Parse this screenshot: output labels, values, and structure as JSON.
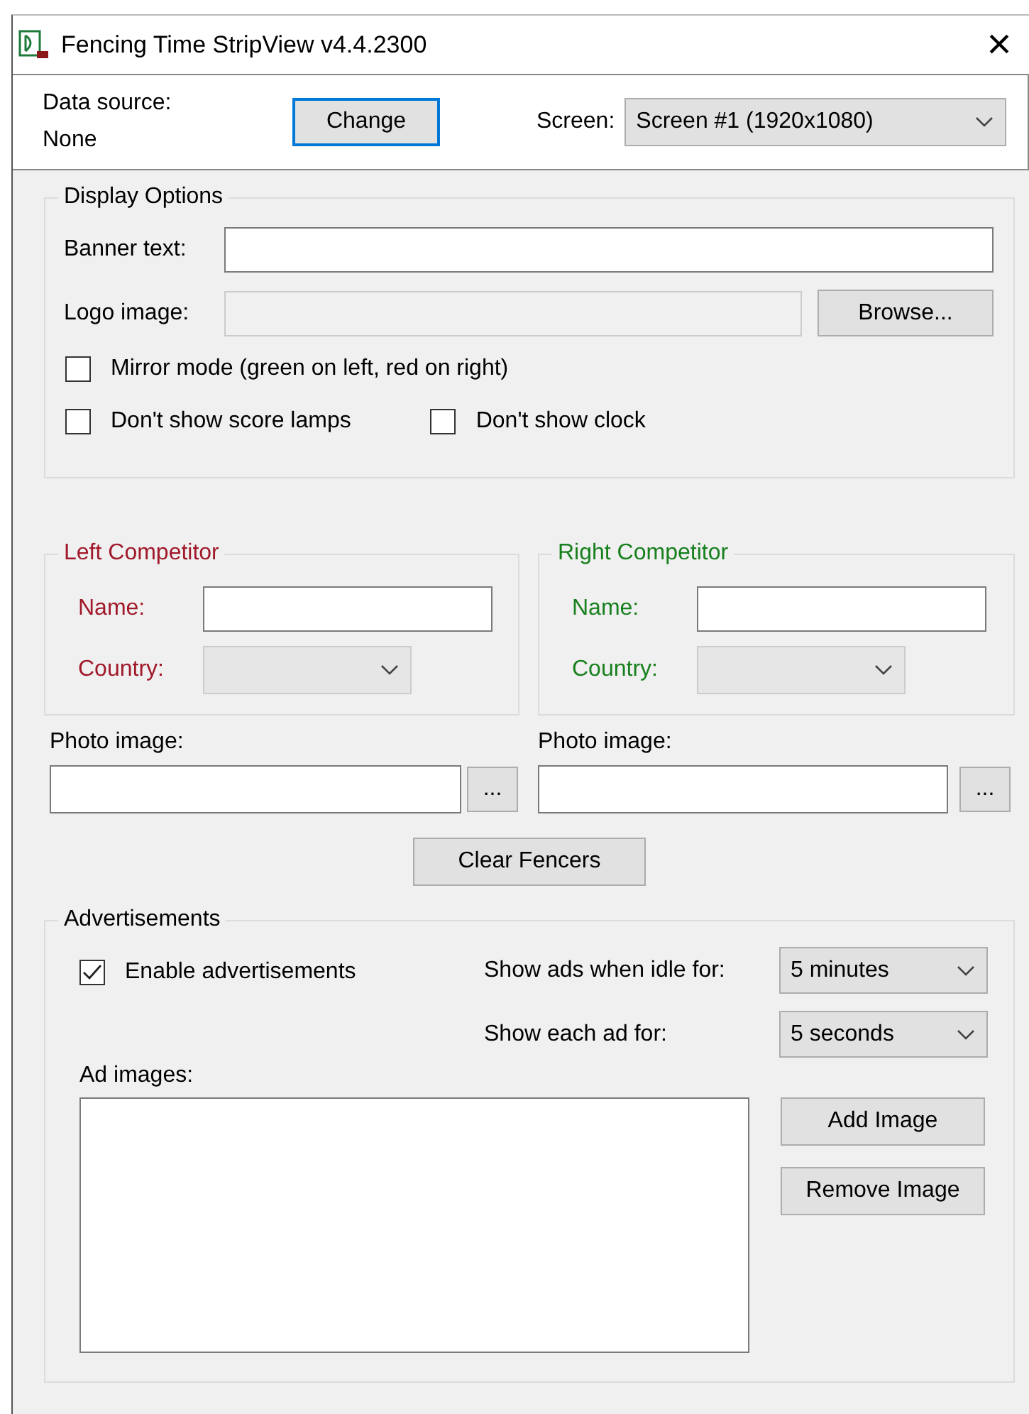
{
  "window": {
    "title": "Fencing Time StripView v4.4.2300",
    "close": "×"
  },
  "header": {
    "data_source_label": "Data source:",
    "data_source_value": "None",
    "change_button": "Change",
    "screen_label": "Screen:",
    "screen_value": "Screen #1 (1920x1080)"
  },
  "display_options": {
    "title": "Display Options",
    "banner_label": "Banner text:",
    "logo_label": "Logo image:",
    "logo_disabled": true,
    "browse_button": "Browse...",
    "checkboxes": [
      {
        "label": "Mirror mode (green on left, red on right)",
        "checked": false
      },
      {
        "label": "Don't show score lamps",
        "checked": false
      },
      {
        "label": "Don't show clock",
        "checked": false
      }
    ]
  },
  "competitors": [
    {
      "title": "Left Competitor",
      "color": "#a0192a",
      "name_label": "Name:",
      "country_label": "Country:",
      "country_disabled": true,
      "photo_label": "Photo image:",
      "photo_button": "..."
    },
    {
      "title": "Right Competitor",
      "color": "#18801e",
      "name_label": "Name:",
      "country_label": "Country:",
      "country_disabled": true,
      "photo_label": "Photo image:",
      "photo_button": "..."
    }
  ],
  "clear_button": "Clear Fencers",
  "advertisements": {
    "title": "Advertisements",
    "enable": {
      "label": "Enable advertisements",
      "checked": true
    },
    "idle_label": "Show ads when idle for:",
    "idle_value": "5 minutes",
    "each_label": "Show each ad for:",
    "each_value": "5 seconds",
    "ad_images_label": "Ad images:",
    "buttons": [
      "Add Image",
      "Remove Image"
    ]
  }
}
